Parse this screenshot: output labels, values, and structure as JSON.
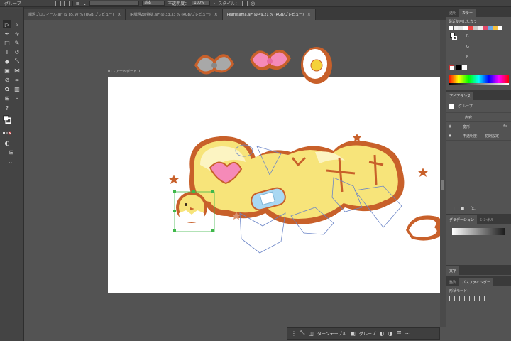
{
  "control_bar": {
    "object_type": "グループ",
    "stroke_profile": "基本",
    "opacity_label": "不透明度：",
    "opacity_value": "100%",
    "style_label": "スタイル："
  },
  "tabs": [
    {
      "label": "課題プロフィール.ai* @ 85.97 % (RGB/プレビュー)",
      "close": "×"
    },
    {
      "label": "IR課題2の特訓.ai* @ 33.33 % (RGB/プレビュー)",
      "close": "×"
    },
    {
      "label": "Pearusama.ai* @ 49.21 % (RGB/プレビュー)",
      "close": "×"
    }
  ],
  "toolbar": {
    "tools": [
      "selection-tool",
      "direct-selection-tool",
      "pen-tool",
      "curvature-tool",
      "rectangle-tool",
      "pencil-tool",
      "type-tool",
      "rotate-tool",
      "eraser-tool",
      "scale-tool",
      "gradient-tool",
      "width-tool",
      "eyedropper-tool",
      "blend-tool",
      "symbol-tool",
      "graph-tool",
      "artboard-tool",
      "slice-tool",
      "hand-tool",
      "zoom-tool"
    ],
    "help_glyph": "?",
    "more_glyph": "···"
  },
  "canvas": {
    "artboard_label": "01 - アートボード 1"
  },
  "bottom_bar": {
    "turntable_label": "ターンテーブル",
    "group_label": "グループ"
  },
  "panels": {
    "color_tabs": [
      "透明",
      "カラー"
    ],
    "recent_colors_label": "最近使用したカラー",
    "slider_labels": [
      "R",
      "G",
      "B"
    ],
    "appearance_tab": "アピアランス",
    "appearance_rows": [
      {
        "label": "グループ",
        "value": ""
      },
      {
        "label": "内容",
        "value": ""
      },
      {
        "label": "変形",
        "value": "fx"
      },
      {
        "label": "不透明度：",
        "value": "初期設定"
      }
    ],
    "gradient_tabs": [
      "グラデーション",
      "シンボル"
    ],
    "type_tab": "文字",
    "path_tabs": [
      "整列",
      "パスファインダー"
    ],
    "shape_mode_label": "形状モード：",
    "fx_label": "fx."
  },
  "colors": {
    "accent_orange": "#c8602a",
    "text_yellow": "#f7e47a",
    "bandage_blue": "#a9d8f2",
    "heart_pink": "#f58ab8",
    "bow_gray": "#a8a8a8",
    "egg_yolk": "#f4d23a"
  }
}
